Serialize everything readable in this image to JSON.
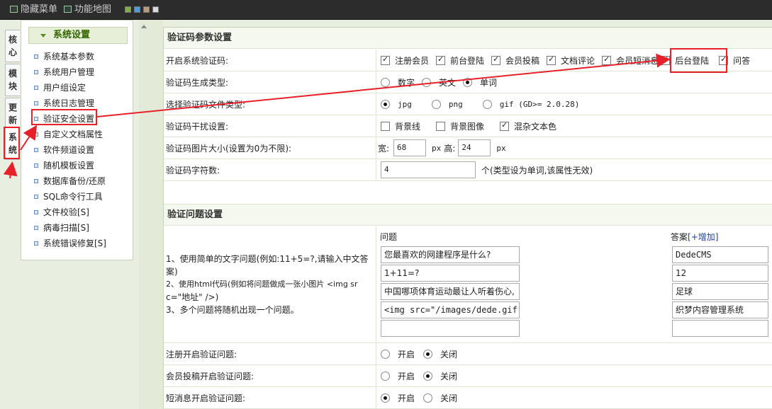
{
  "topbar": {
    "hide_menu": "隐藏菜单",
    "site_map": "功能地图",
    "swatches": [
      "#7fb043",
      "#4f9bd6",
      "#b89b7a",
      "#d9d9d9"
    ]
  },
  "left_tabs": [
    {
      "label": "核心",
      "active": false
    },
    {
      "label": "模块",
      "active": false
    },
    {
      "label": "更新",
      "active": false
    },
    {
      "label": "系统",
      "active": true
    }
  ],
  "menu": {
    "title": "系统设置",
    "items": [
      "系统基本参数",
      "系统用户管理",
      "用户组设定",
      "系统日志管理",
      "验证安全设置",
      "自定义文档属性",
      "软件频道设置",
      "随机模板设置",
      "数据库备份/还原",
      "SQL命令行工具",
      "文件校验[S]",
      "病毒扫描[S]",
      "系统错误修复[S]"
    ]
  },
  "captcha": {
    "section_title": "验证码参数设置",
    "enable_label": "开启系统验证码:",
    "enable_options": [
      {
        "label": "注册会员",
        "checked": true
      },
      {
        "label": "前台登陆",
        "checked": true
      },
      {
        "label": "会员投稿",
        "checked": true
      },
      {
        "label": "文档评论",
        "checked": true
      },
      {
        "label": "会员短消息",
        "checked": true
      },
      {
        "label": "后台登陆",
        "checked": true
      },
      {
        "label": "问答",
        "checked": true
      }
    ],
    "type_label": "验证码生成类型:",
    "type_options": [
      {
        "label": "数字",
        "checked": false
      },
      {
        "label": "英文",
        "checked": false
      },
      {
        "label": "单词",
        "checked": true
      }
    ],
    "filetype_label": "选择验证码文件类型:",
    "filetype_options": [
      {
        "label": "jpg",
        "checked": true
      },
      {
        "label": "png",
        "checked": false
      },
      {
        "label": "gif (GD>= 2.0.28)",
        "checked": false
      }
    ],
    "noise_label": "验证码干扰设置:",
    "noise_options": [
      {
        "label": "背景线",
        "checked": false
      },
      {
        "label": "背景图像",
        "checked": false
      },
      {
        "label": "混杂文本色",
        "checked": true
      }
    ],
    "size_label": "验证码图片大小(设置为0为不限):",
    "width_label": "宽:",
    "width_value": "68",
    "height_label": "高:",
    "height_value": "24",
    "px_unit": "px",
    "chars_label": "验证码字符数:",
    "chars_value": "4",
    "chars_note": "个(类型设为单词,该属性无效)"
  },
  "question": {
    "section_title": "验证问题设置",
    "help_lines": [
      "1、使用简单的文字问题(例如:11+5=?,请输入中文答",
      "案)",
      "2、使用html代码(例如将问题做成一张小图片 <img sr",
      "c=\"地址\" />)",
      "3、多个问题将随机出现一个问题。"
    ],
    "col_question": "问题",
    "col_answer": "答案",
    "add_link": "[+增加]",
    "pairs": [
      {
        "q": "您最喜欢的网建程序是什么?",
        "a": "DedeCMS"
      },
      {
        "q": "1+11=?",
        "a": "12"
      },
      {
        "q": "中国哪项体育运动最让人听着伤心,",
        "a": "足球"
      },
      {
        "q": "<img src=\"/images/dede.gif\"/>",
        "a": "织梦内容管理系统"
      },
      {
        "q": "",
        "a": ""
      }
    ],
    "toggles": [
      {
        "label": "注册开启验证问题:",
        "on_label": "开启",
        "off_label": "关闭",
        "on": false
      },
      {
        "label": "会员投稿开启验证问题:",
        "on_label": "开启",
        "off_label": "关闭",
        "on": false
      },
      {
        "label": "短消息开启验证问题:",
        "on_label": "开启",
        "off_label": "关闭",
        "on": true
      }
    ]
  }
}
